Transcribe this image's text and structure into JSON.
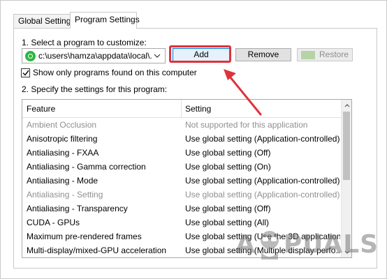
{
  "tabs": {
    "global_label": "Global Settings",
    "program_label": "Program Settings"
  },
  "section1": {
    "label": "1. Select a program to customize:",
    "program_select_value": "c:\\users\\hamza\\appdata\\local\\...",
    "add_label": "Add",
    "remove_label": "Remove",
    "restore_label": "Restore",
    "show_only_label": "Show only programs found on this computer",
    "show_only_checked": true
  },
  "section2": {
    "label": "2. Specify the settings for this program:",
    "headers": {
      "feature": "Feature",
      "setting": "Setting"
    },
    "rows": [
      {
        "feature": "Ambient Occlusion",
        "setting": "Not supported for this application",
        "disabled": true
      },
      {
        "feature": "Anisotropic filtering",
        "setting": "Use global setting (Application-controlled)",
        "disabled": false
      },
      {
        "feature": "Antialiasing - FXAA",
        "setting": "Use global setting (Off)",
        "disabled": false
      },
      {
        "feature": "Antialiasing - Gamma correction",
        "setting": "Use global setting (On)",
        "disabled": false
      },
      {
        "feature": "Antialiasing - Mode",
        "setting": "Use global setting (Application-controlled)",
        "disabled": false
      },
      {
        "feature": "Antialiasing - Setting",
        "setting": "Use global setting (Application-controlled)",
        "disabled": true
      },
      {
        "feature": "Antialiasing - Transparency",
        "setting": "Use global setting (Off)",
        "disabled": false
      },
      {
        "feature": "CUDA - GPUs",
        "setting": "Use global setting (All)",
        "disabled": false
      },
      {
        "feature": "Maximum pre-rendered frames",
        "setting": "Use global setting (Use the 3D application ...",
        "disabled": false
      },
      {
        "feature": "Multi-display/mixed-GPU acceleration",
        "setting": "Use global setting (Multiple display perfo...",
        "disabled": false
      }
    ]
  },
  "watermark": {
    "text_left": "A",
    "text_right": "PUALS"
  },
  "colors": {
    "highlight": "#e0323a",
    "whatsapp": "#2bb741",
    "disabled_text": "#8f8f8f"
  },
  "icons": {
    "program": "whatsapp-icon",
    "dropdown": "chevron-down-icon",
    "restore": "nvidia-icon",
    "scroll_up": "chevron-up-icon",
    "scroll_down": "chevron-down-icon",
    "annotation": "arrow-icon"
  }
}
